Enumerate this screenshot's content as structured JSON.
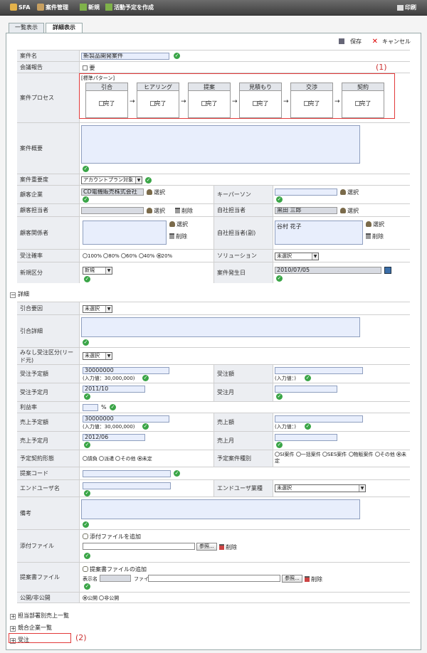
{
  "topbar": {
    "brand": "SFA",
    "module": "案件管理",
    "new_label": "新規",
    "activity_label": "活動予定を作成",
    "print_label": "印刷"
  },
  "tabs": [
    "一覧表示",
    "詳細表示"
  ],
  "actions": {
    "save": "保存",
    "cancel": "キャンセル"
  },
  "callouts": {
    "c1": "(1)",
    "c2": "(2)"
  },
  "fields": {
    "case_name": {
      "label": "案件名",
      "value": "新製品開発案件"
    },
    "report": {
      "label": "会議報告",
      "option": "要"
    },
    "process": {
      "label": "案件プロセス",
      "pattern": "[標準パターン]",
      "stages": [
        "引合",
        "ヒアリング",
        "提案",
        "見積もり",
        "交渉",
        "契約"
      ],
      "done": "完了"
    },
    "summary": {
      "label": "案件概要"
    },
    "importance": {
      "label": "案件重要度",
      "value": "アカウントプラン対象"
    },
    "client": {
      "label": "顧客企業",
      "value": "CD電機販売株式会社",
      "select": "選択"
    },
    "keyperson": {
      "label": "キーパーソン",
      "select": "選択"
    },
    "client_contact": {
      "label": "顧客担当者",
      "select": "選択",
      "delete": "削除"
    },
    "owner": {
      "label": "自社担当者",
      "value": "黒田 三郎",
      "select": "選択"
    },
    "client_related": {
      "label": "顧客関係者",
      "select": "選択",
      "delete": "削除"
    },
    "owner_sub": {
      "label": "自社担当者(副)",
      "value": "谷村 花子",
      "select": "選択",
      "delete": "削除"
    },
    "probability": {
      "label": "受注確率",
      "options": [
        "100%",
        "80%",
        "60%",
        "40%",
        "20%"
      ],
      "selected": "20%"
    },
    "solution": {
      "label": "ソリューション",
      "value": "未選択"
    },
    "new_type": {
      "label": "新規区分",
      "value": "新規"
    },
    "occurred": {
      "label": "案件発生日",
      "value": "2010/07/05"
    }
  },
  "detail": {
    "toggle": "詳細",
    "inquiry_reason": {
      "label": "引合要因",
      "value": "未選択"
    },
    "inquiry_detail": {
      "label": "引合詳細"
    },
    "lead_source": {
      "label": "みなし受注区分(リード元)",
      "value": "未選択"
    },
    "order_planned_amount": {
      "label": "受注予定額",
      "value": "30000000",
      "hint": "(入力値：30,000,000)"
    },
    "order_amount": {
      "label": "受注額",
      "hint": "(入力値：)"
    },
    "order_planned_month": {
      "label": "受注予定月",
      "value": "2011/10"
    },
    "order_month": {
      "label": "受注月"
    },
    "profit_rate": {
      "label": "利益率",
      "unit": "%"
    },
    "sales_planned_amount": {
      "label": "売上予定額",
      "value": "30000000",
      "hint": "(入力値：30,000,000)"
    },
    "sales_amount": {
      "label": "売上額",
      "hint": "(入力値：)"
    },
    "sales_planned_month": {
      "label": "売上予定月",
      "value": "2012/06"
    },
    "sales_month": {
      "label": "売上月"
    },
    "contract_form": {
      "label": "予定契約形態",
      "options": [
        "請負",
        "派遣",
        "その他",
        "未定"
      ],
      "selected": "未定"
    },
    "case_type": {
      "label": "予定案件種別",
      "options": [
        "SI案件",
        "一括案件",
        "SES案件",
        "物販案件",
        "その他",
        "未定"
      ],
      "selected": "未定"
    },
    "proposal_code": {
      "label": "提案コード"
    },
    "end_user": {
      "label": "エンドユーザ名"
    },
    "end_user_industry": {
      "label": "エンドユーザ業種",
      "value": "未選択"
    },
    "remarks": {
      "label": "備考"
    },
    "attachment": {
      "label": "添付ファイル",
      "add": "添付ファイルを追加",
      "browse": "参照...",
      "delete": "削除"
    },
    "proposal_file": {
      "label": "提案書ファイル",
      "add": "提案書ファイルの追加",
      "display_name": "表示名",
      "file": "ファイル",
      "browse": "参照...",
      "delete": "削除"
    },
    "public": {
      "label": "公開/非公開",
      "options": [
        "公開",
        "非公開"
      ],
      "selected": "公開"
    }
  },
  "bottom_sections": [
    "担当部署別売上一覧",
    "競合企業一覧",
    "受注"
  ]
}
